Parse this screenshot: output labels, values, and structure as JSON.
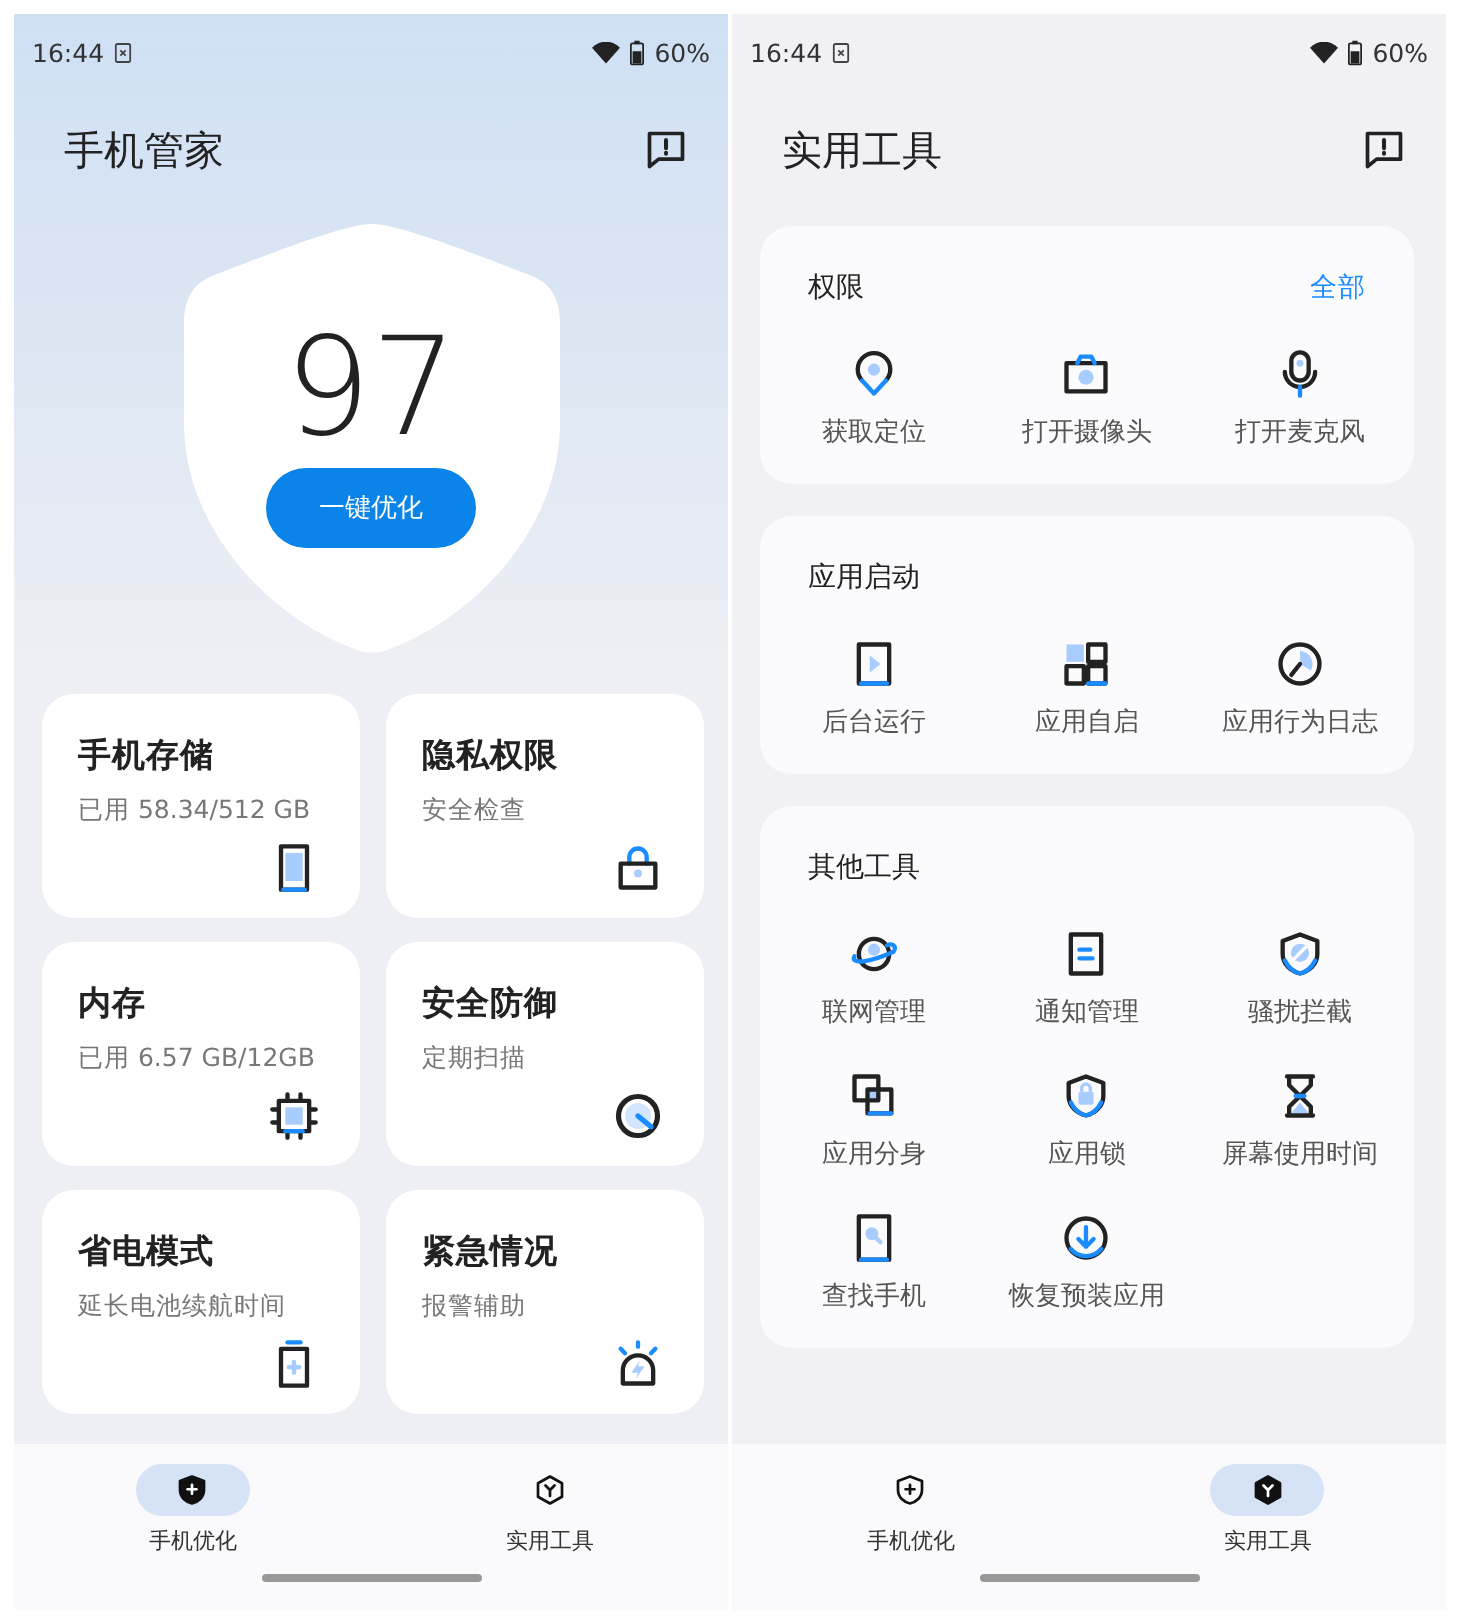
{
  "screens": [
    {
      "kind": "home",
      "status_bar": {
        "time": "16:44",
        "battery": "60%"
      },
      "title": "手机管家",
      "score": "97",
      "optimize_button": "一键优化",
      "cards": [
        {
          "title": "手机存储",
          "subtitle": "已用 58.34/512 GB"
        },
        {
          "title": "隐私权限",
          "subtitle": "安全检查"
        },
        {
          "title": "内存",
          "subtitle": "已用 6.57 GB/12GB"
        },
        {
          "title": "安全防御",
          "subtitle": "定期扫描"
        },
        {
          "title": "省电模式",
          "subtitle": "延长电池续航时间"
        },
        {
          "title": "紧急情况",
          "subtitle": "报警辅助"
        }
      ],
      "nav": [
        {
          "label": "手机优化",
          "selected": true
        },
        {
          "label": "实用工具",
          "selected": false
        }
      ]
    },
    {
      "kind": "tools",
      "status_bar": {
        "time": "16:44",
        "battery": "60%"
      },
      "title": "实用工具",
      "sections": [
        {
          "title": "权限",
          "link": "全部",
          "items": [
            "获取定位",
            "打开摄像头",
            "打开麦克风"
          ]
        },
        {
          "title": "应用启动",
          "items": [
            "后台运行",
            "应用自启",
            "应用行为日志"
          ]
        },
        {
          "title": "其他工具",
          "items": [
            "联网管理",
            "通知管理",
            "骚扰拦截",
            "应用分身",
            "应用锁",
            "屏幕使用时间",
            "查找手机",
            "恢复预装应用"
          ]
        }
      ],
      "nav": [
        {
          "label": "手机优化",
          "selected": false
        },
        {
          "label": "实用工具",
          "selected": true
        }
      ]
    }
  ]
}
